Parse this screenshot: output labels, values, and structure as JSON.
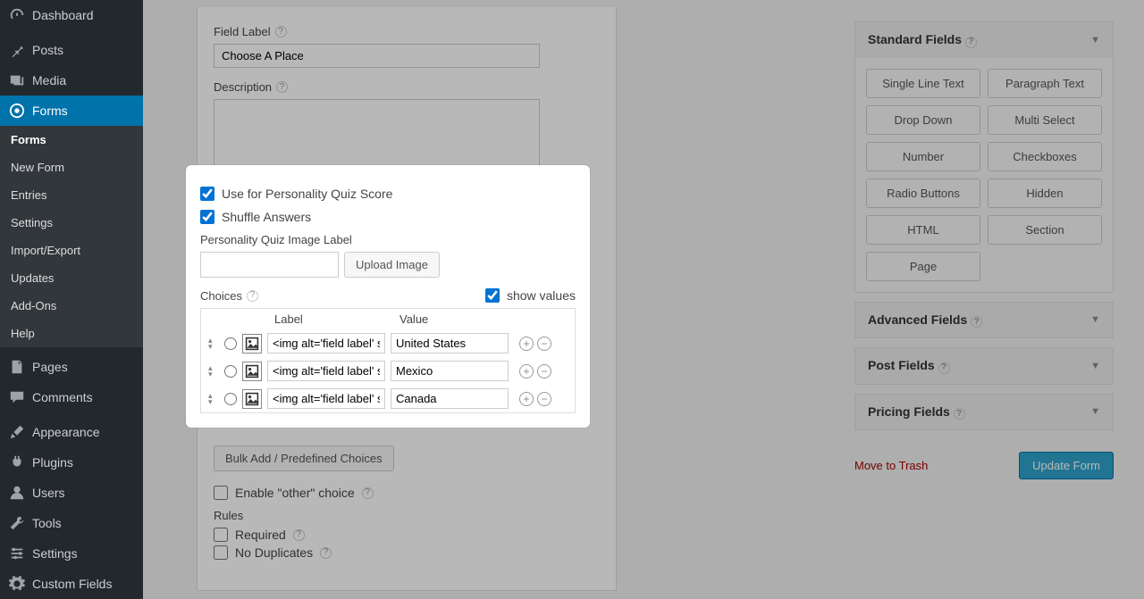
{
  "sidebar": {
    "dashboard": "Dashboard",
    "posts": "Posts",
    "media": "Media",
    "forms": "Forms",
    "pages": "Pages",
    "comments": "Comments",
    "appearance": "Appearance",
    "plugins": "Plugins",
    "users": "Users",
    "tools": "Tools",
    "settings": "Settings",
    "custom": "Custom Fields",
    "sub": {
      "forms": "Forms",
      "new_form": "New Form",
      "entries": "Entries",
      "settings": "Settings",
      "import_export": "Import/Export",
      "updates": "Updates",
      "addons": "Add-Ons",
      "help": "Help"
    }
  },
  "form": {
    "field_label_lbl": "Field Label",
    "field_label_val": "Choose A Place",
    "description_lbl": "Description",
    "quiz_score": "Use for Personality Quiz Score",
    "shuffle": "Shuffle Answers",
    "img_label": "Personality Quiz Image Label",
    "upload_btn": "Upload Image",
    "choices_lbl": "Choices",
    "show_values": "show values",
    "th_label": "Label",
    "th_value": "Value",
    "rows": [
      {
        "label": "<img alt='field label' src",
        "value": "United States"
      },
      {
        "label": "<img alt='field label' src",
        "value": "Mexico"
      },
      {
        "label": "<img alt='field label' src",
        "value": "Canada"
      }
    ],
    "bulk_btn": "Bulk Add / Predefined Choices",
    "enable_other": "Enable \"other\" choice",
    "rules": "Rules",
    "required": "Required",
    "no_dup": "No Duplicates"
  },
  "panels": {
    "standard": "Standard Fields",
    "advanced": "Advanced Fields",
    "post": "Post Fields",
    "pricing": "Pricing Fields",
    "fields": [
      "Single Line Text",
      "Paragraph Text",
      "Drop Down",
      "Multi Select",
      "Number",
      "Checkboxes",
      "Radio Buttons",
      "Hidden",
      "HTML",
      "Section",
      "Page"
    ]
  },
  "actions": {
    "trash": "Move to Trash",
    "update": "Update Form"
  }
}
